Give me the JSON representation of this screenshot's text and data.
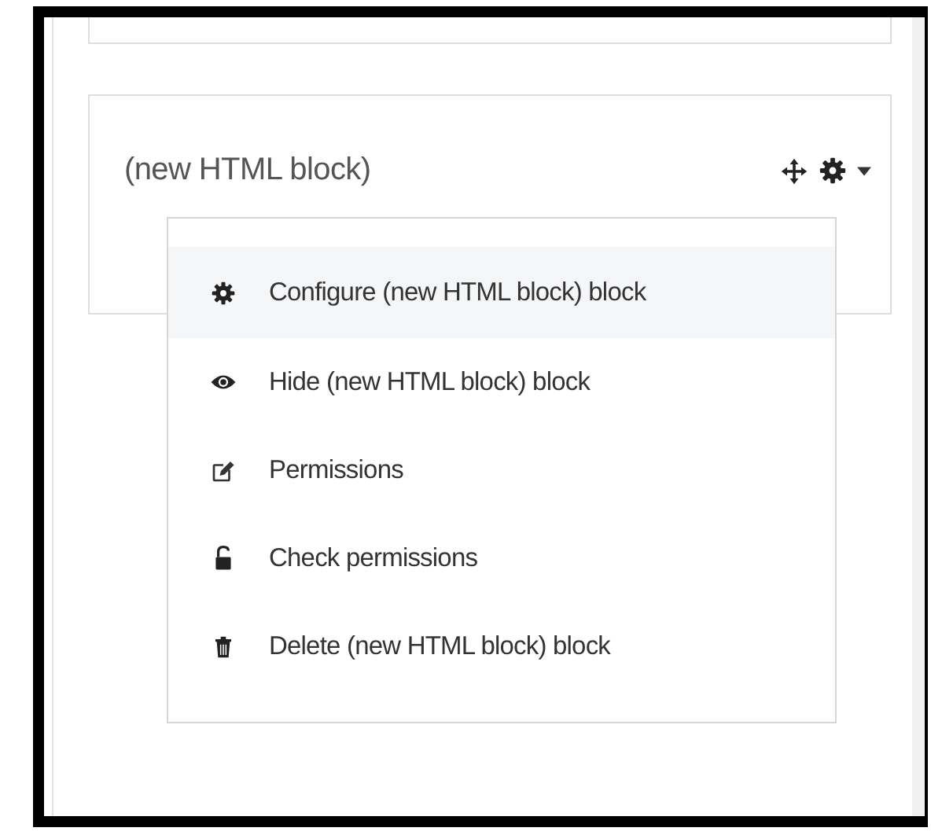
{
  "block": {
    "title": "(new HTML block)"
  },
  "menu": {
    "items": [
      {
        "label": "Configure (new HTML block) block",
        "selected": true
      },
      {
        "label": "Hide (new HTML block) block",
        "selected": false
      },
      {
        "label": "Permissions",
        "selected": false
      },
      {
        "label": "Check permissions",
        "selected": false
      },
      {
        "label": "Delete (new HTML block) block",
        "selected": false
      }
    ]
  }
}
